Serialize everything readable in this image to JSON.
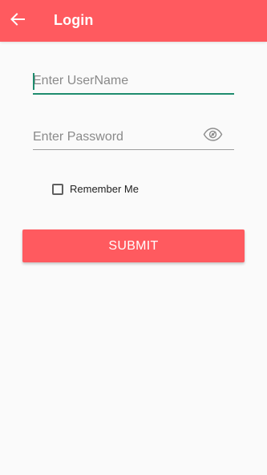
{
  "app_bar": {
    "title": "Login",
    "back_icon": "arrow-back-icon",
    "color": "#ff5a5f"
  },
  "form": {
    "username": {
      "value": "",
      "placeholder": "Enter UserName",
      "accent_color": "#1e8c6e"
    },
    "password": {
      "value": "",
      "placeholder": "Enter Password",
      "toggle_icon": "eye-icon"
    },
    "remember_me": {
      "label": "Remember Me",
      "checked": false
    },
    "submit_label": "SUBMIT",
    "submit_color": "#ff5a5f"
  }
}
